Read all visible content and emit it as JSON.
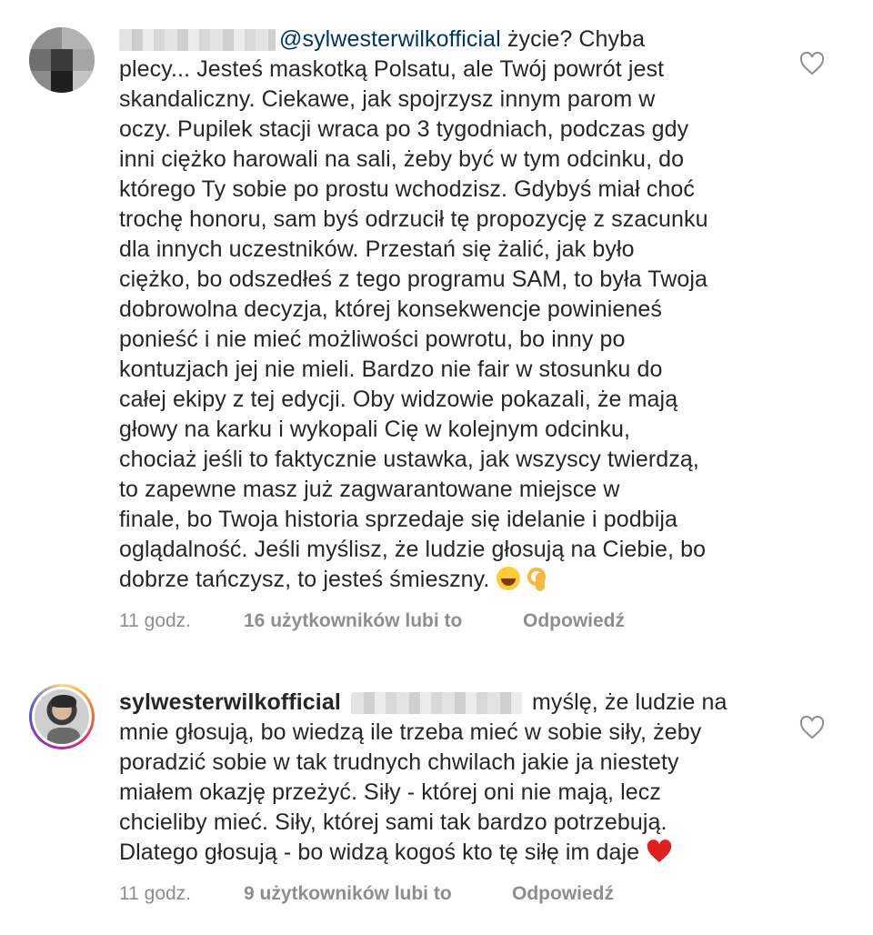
{
  "comments": [
    {
      "mention": "@sylwesterwilkofficial",
      "lines": [
        "życie? Chyba",
        "plecy... Jesteś maskotką Polsatu, ale Twój powrót jest",
        "skandaliczny. Ciekawe, jak spojrzysz innym parom w",
        "oczy. Pupilek stacji wraca po 3 tygodniach, podczas gdy",
        "inni ciężko harowali na sali, żeby być w tym odcinku, do",
        "którego Ty sobie po prostu wchodzisz. Gdybyś miał choć",
        "trochę honoru, sam byś odrzucił tę propozycję z szacunku",
        "dla innych uczestników. Przestań się żalić, jak było",
        "ciężko, bo odszedłeś z tego programu SAM, to była Twoja",
        "dobrowolna decyzja, której konsekwencje powinieneś",
        "ponieść i nie mieć możliwości powrotu, bo inny po",
        "kontuzjach jej nie mieli. Bardzo nie fair w stosunku do",
        "całej ekipy z tej edycji. Oby widzowie pokazali, że mają",
        "głowy na karku i wykopali Cię w kolejnym odcinku,",
        "chociaż jeśli to faktycznie ustawka, jak wszyscy twierdzą,",
        "to zapewne masz już zagwarantowane miejsce w",
        "finale, bo Twoja historia sprzedaje się idelanie i podbija",
        "oglądalność. Jeśli myślisz, że ludzie głosują na Ciebie, bo",
        "dobrze tańczysz, to jesteś śmieszny."
      ],
      "emojis": [
        "face-with-tears-of-joy",
        "ok-hand"
      ],
      "time": "11 godz.",
      "likes": "16 użytkowników lubi to",
      "reply": "Odpowiedź"
    },
    {
      "username": "sylwesterwilkofficial",
      "lines": [
        "myślę, że ludzie na",
        "mnie głosują, bo wiedzą ile trzeba mieć w sobie siły, żeby",
        "poradzić sobie w tak trudnych chwilach jakie ja niestety",
        "miałem okazję przeżyć. Siły - której oni nie mają, lecz",
        "chcieliby mieć. Siły, której sami tak bardzo potrzebują.",
        "Dlatego głosują - bo widzą kogoś kto tę siłę im daje"
      ],
      "emojis": [
        "red-heart"
      ],
      "time": "11 godz.",
      "likes": "9 użytkowników lubi to",
      "reply": "Odpowiedź"
    }
  ],
  "colors": {
    "text": "#262626",
    "meta": "#8e8e8e",
    "mention": "#003569",
    "heart_emoji": "#e0201c"
  }
}
